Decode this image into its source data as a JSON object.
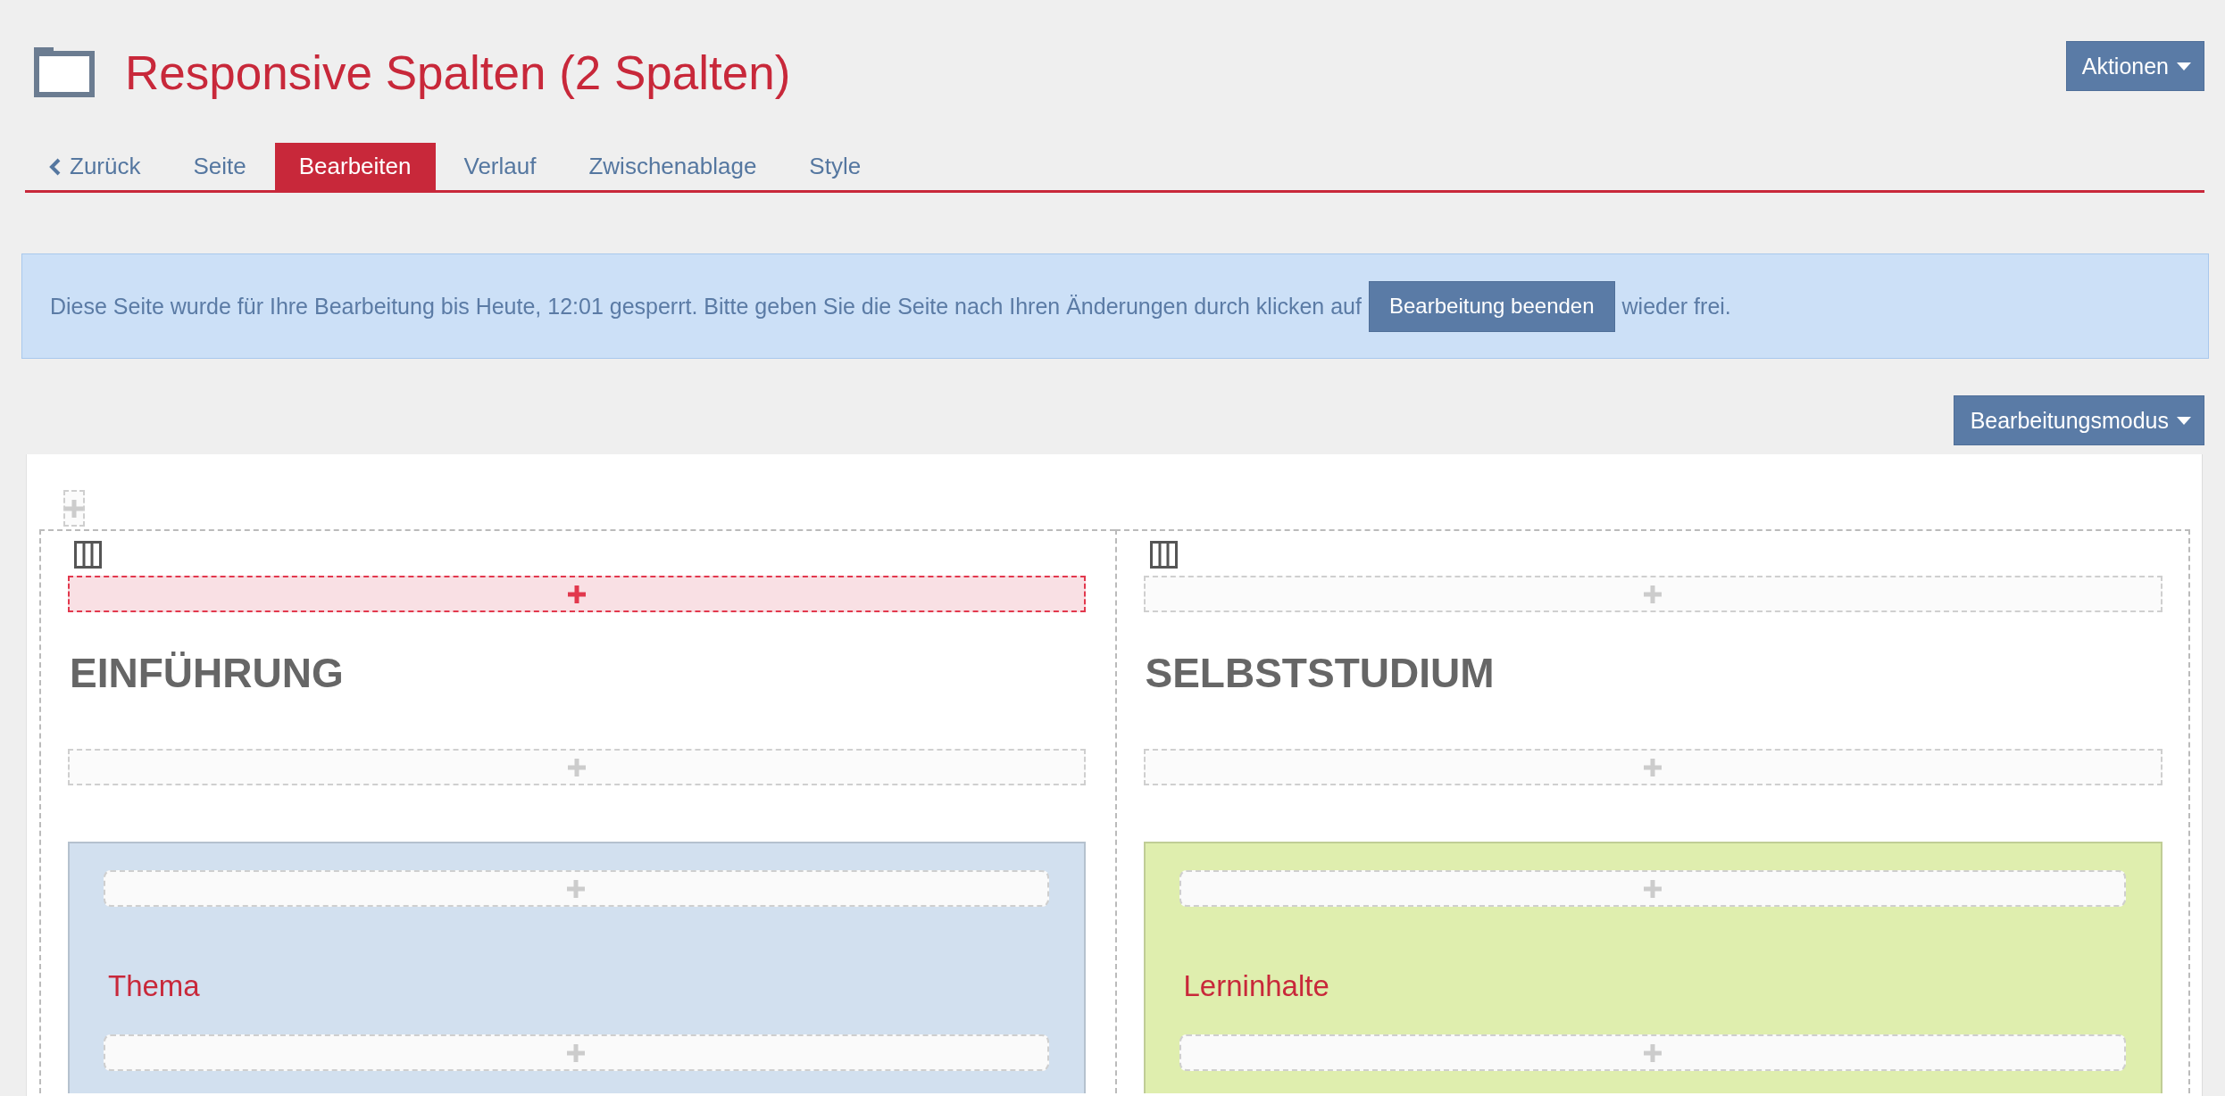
{
  "header": {
    "title": "Responsive Spalten (2 Spalten)",
    "actions_button": "Aktionen"
  },
  "tabs": [
    {
      "label": "Zurück",
      "kind": "back",
      "selected": false
    },
    {
      "label": "Seite",
      "kind": "tab",
      "selected": false
    },
    {
      "label": "Bearbeiten",
      "kind": "tab",
      "selected": true
    },
    {
      "label": "Verlauf",
      "kind": "tab",
      "selected": false
    },
    {
      "label": "Zwischenablage",
      "kind": "tab",
      "selected": false
    },
    {
      "label": "Style",
      "kind": "tab",
      "selected": false
    }
  ],
  "lock_notice": {
    "text_before": "Diese Seite wurde für Ihre Bearbeitung bis Heute, 12:01 gesperrt. Bitte geben Sie die Seite nach Ihren Änderungen durch klicken auf",
    "button": "Bearbeitung beenden",
    "text_after": "wieder frei."
  },
  "mode_button": "Bearbeitungsmodus",
  "editor": {
    "top_slot": {
      "active": false
    },
    "columns": [
      {
        "blocks": [
          {
            "kind": "slot",
            "active": true
          },
          {
            "kind": "heading",
            "text": "EINFÜHRUNG"
          },
          {
            "kind": "slot",
            "active": false
          },
          {
            "kind": "panel",
            "color": "#d2e0ef",
            "blocks": [
              {
                "kind": "slot",
                "active": false
              },
              {
                "kind": "title",
                "text": "Thema"
              },
              {
                "kind": "slot",
                "active": false
              }
            ]
          }
        ]
      },
      {
        "blocks": [
          {
            "kind": "slot",
            "active": false
          },
          {
            "kind": "heading",
            "text": "SELBSTSTUDIUM"
          },
          {
            "kind": "slot",
            "active": false
          },
          {
            "kind": "panel",
            "color": "#dfeeae",
            "blocks": [
              {
                "kind": "slot",
                "active": false
              },
              {
                "kind": "title",
                "text": "Lerninhalte"
              },
              {
                "kind": "slot",
                "active": false
              }
            ]
          }
        ]
      }
    ]
  }
}
